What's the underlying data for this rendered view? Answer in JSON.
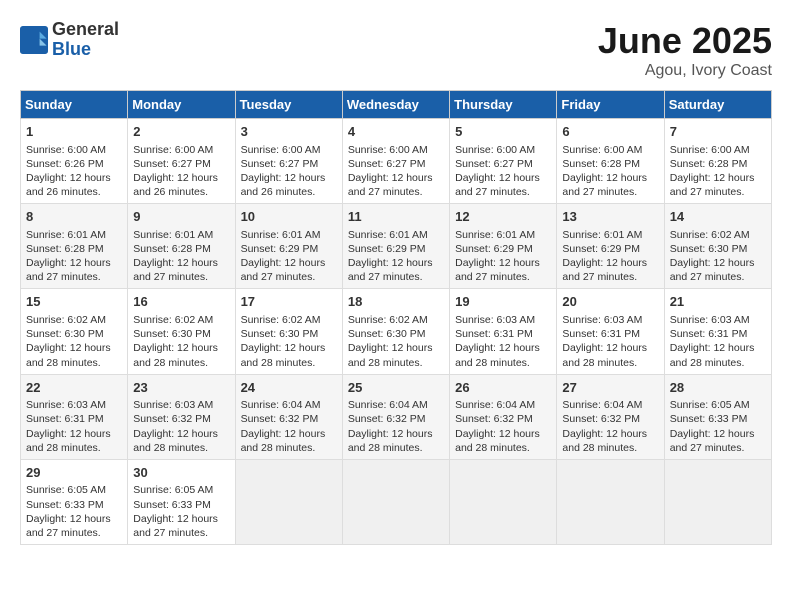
{
  "header": {
    "logo_general": "General",
    "logo_blue": "Blue",
    "title": "June 2025",
    "subtitle": "Agou, Ivory Coast"
  },
  "weekdays": [
    "Sunday",
    "Monday",
    "Tuesday",
    "Wednesday",
    "Thursday",
    "Friday",
    "Saturday"
  ],
  "weeks": [
    [
      {
        "day": "1",
        "sunrise": "6:00 AM",
        "sunset": "6:26 PM",
        "daylight": "12 hours and 26 minutes."
      },
      {
        "day": "2",
        "sunrise": "6:00 AM",
        "sunset": "6:27 PM",
        "daylight": "12 hours and 26 minutes."
      },
      {
        "day": "3",
        "sunrise": "6:00 AM",
        "sunset": "6:27 PM",
        "daylight": "12 hours and 26 minutes."
      },
      {
        "day": "4",
        "sunrise": "6:00 AM",
        "sunset": "6:27 PM",
        "daylight": "12 hours and 27 minutes."
      },
      {
        "day": "5",
        "sunrise": "6:00 AM",
        "sunset": "6:27 PM",
        "daylight": "12 hours and 27 minutes."
      },
      {
        "day": "6",
        "sunrise": "6:00 AM",
        "sunset": "6:28 PM",
        "daylight": "12 hours and 27 minutes."
      },
      {
        "day": "7",
        "sunrise": "6:00 AM",
        "sunset": "6:28 PM",
        "daylight": "12 hours and 27 minutes."
      }
    ],
    [
      {
        "day": "8",
        "sunrise": "6:01 AM",
        "sunset": "6:28 PM",
        "daylight": "12 hours and 27 minutes."
      },
      {
        "day": "9",
        "sunrise": "6:01 AM",
        "sunset": "6:28 PM",
        "daylight": "12 hours and 27 minutes."
      },
      {
        "day": "10",
        "sunrise": "6:01 AM",
        "sunset": "6:29 PM",
        "daylight": "12 hours and 27 minutes."
      },
      {
        "day": "11",
        "sunrise": "6:01 AM",
        "sunset": "6:29 PM",
        "daylight": "12 hours and 27 minutes."
      },
      {
        "day": "12",
        "sunrise": "6:01 AM",
        "sunset": "6:29 PM",
        "daylight": "12 hours and 27 minutes."
      },
      {
        "day": "13",
        "sunrise": "6:01 AM",
        "sunset": "6:29 PM",
        "daylight": "12 hours and 27 minutes."
      },
      {
        "day": "14",
        "sunrise": "6:02 AM",
        "sunset": "6:30 PM",
        "daylight": "12 hours and 27 minutes."
      }
    ],
    [
      {
        "day": "15",
        "sunrise": "6:02 AM",
        "sunset": "6:30 PM",
        "daylight": "12 hours and 28 minutes."
      },
      {
        "day": "16",
        "sunrise": "6:02 AM",
        "sunset": "6:30 PM",
        "daylight": "12 hours and 28 minutes."
      },
      {
        "day": "17",
        "sunrise": "6:02 AM",
        "sunset": "6:30 PM",
        "daylight": "12 hours and 28 minutes."
      },
      {
        "day": "18",
        "sunrise": "6:02 AM",
        "sunset": "6:30 PM",
        "daylight": "12 hours and 28 minutes."
      },
      {
        "day": "19",
        "sunrise": "6:03 AM",
        "sunset": "6:31 PM",
        "daylight": "12 hours and 28 minutes."
      },
      {
        "day": "20",
        "sunrise": "6:03 AM",
        "sunset": "6:31 PM",
        "daylight": "12 hours and 28 minutes."
      },
      {
        "day": "21",
        "sunrise": "6:03 AM",
        "sunset": "6:31 PM",
        "daylight": "12 hours and 28 minutes."
      }
    ],
    [
      {
        "day": "22",
        "sunrise": "6:03 AM",
        "sunset": "6:31 PM",
        "daylight": "12 hours and 28 minutes."
      },
      {
        "day": "23",
        "sunrise": "6:03 AM",
        "sunset": "6:32 PM",
        "daylight": "12 hours and 28 minutes."
      },
      {
        "day": "24",
        "sunrise": "6:04 AM",
        "sunset": "6:32 PM",
        "daylight": "12 hours and 28 minutes."
      },
      {
        "day": "25",
        "sunrise": "6:04 AM",
        "sunset": "6:32 PM",
        "daylight": "12 hours and 28 minutes."
      },
      {
        "day": "26",
        "sunrise": "6:04 AM",
        "sunset": "6:32 PM",
        "daylight": "12 hours and 28 minutes."
      },
      {
        "day": "27",
        "sunrise": "6:04 AM",
        "sunset": "6:32 PM",
        "daylight": "12 hours and 28 minutes."
      },
      {
        "day": "28",
        "sunrise": "6:05 AM",
        "sunset": "6:33 PM",
        "daylight": "12 hours and 27 minutes."
      }
    ],
    [
      {
        "day": "29",
        "sunrise": "6:05 AM",
        "sunset": "6:33 PM",
        "daylight": "12 hours and 27 minutes."
      },
      {
        "day": "30",
        "sunrise": "6:05 AM",
        "sunset": "6:33 PM",
        "daylight": "12 hours and 27 minutes."
      },
      null,
      null,
      null,
      null,
      null
    ]
  ],
  "labels": {
    "sunrise_prefix": "Sunrise: ",
    "sunset_prefix": "Sunset: ",
    "daylight_prefix": "Daylight: "
  }
}
